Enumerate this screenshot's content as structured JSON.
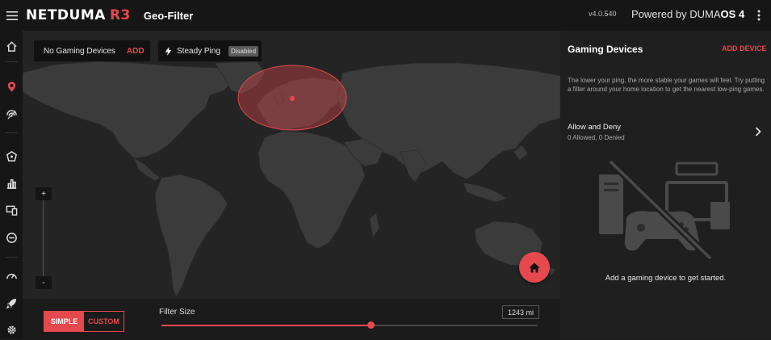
{
  "header": {
    "logo_main": "NETDUMA",
    "logo_model": "R3",
    "page_title": "Geo-Filter",
    "version": "v4.0.540",
    "powered_prefix": "Powered by DUMA",
    "powered_suffix": "OS 4"
  },
  "nav": {
    "items": [
      "home-icon",
      "geo-filter-icon",
      "ping-heatmap-icon",
      "shield-icon",
      "chart-icon",
      "devices-icon",
      "block-icon",
      "speedometer-icon",
      "rocket-icon",
      "gear-icon"
    ],
    "active": "geo-filter-icon"
  },
  "map": {
    "devices_label": "No Gaming Devices",
    "devices_add": "ADD",
    "ping_label": "Steady Ping",
    "ping_status": "Disabled",
    "zoom_in": "+",
    "zoom_out": "-"
  },
  "filter": {
    "mode_simple": "SIMPLE",
    "mode_custom": "CUSTOM",
    "active_mode": "SIMPLE",
    "size_label": "Filter Size",
    "size_value": "1243 mi",
    "slider_fraction": 0.556
  },
  "panel": {
    "title": "Gaming Devices",
    "add_label": "ADD DEVICE",
    "description": "The lower your ping, the more stable your games will feel. Try putting a filter around your home location to get the nearest low-ping games.",
    "allow_deny_title": "Allow and Deny",
    "allow_deny_sub": "0 Allowed, 0 Denied",
    "empty_text": "Add a gaming device to get started."
  },
  "colors": {
    "accent": "#e5484d",
    "background": "#1b1b1b",
    "map_land": "#3a3a3a",
    "map_water": "#242424"
  }
}
